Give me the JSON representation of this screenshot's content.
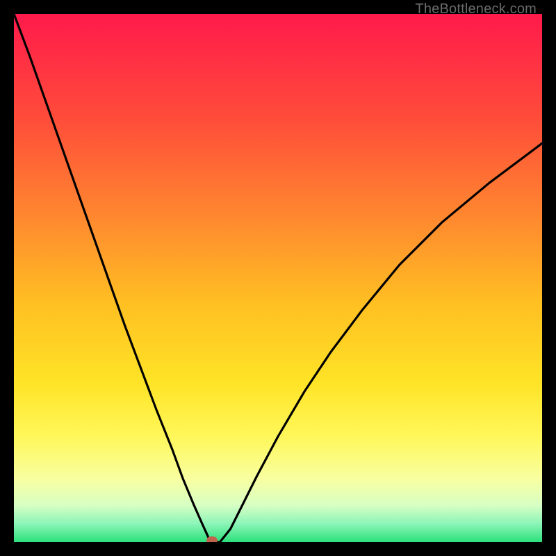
{
  "watermark": "TheBottleneck.com",
  "chart_data": {
    "type": "line",
    "title": "",
    "xlabel": "",
    "ylabel": "",
    "xlim": [
      0,
      100
    ],
    "ylim": [
      0,
      100
    ],
    "grid": false,
    "legend": false,
    "background_gradient": {
      "stops": [
        {
          "pos": 0.0,
          "color": "#ff1a4b"
        },
        {
          "pos": 0.2,
          "color": "#ff4d3a"
        },
        {
          "pos": 0.4,
          "color": "#ff8d2e"
        },
        {
          "pos": 0.55,
          "color": "#ffc022"
        },
        {
          "pos": 0.7,
          "color": "#ffe427"
        },
        {
          "pos": 0.8,
          "color": "#fff75a"
        },
        {
          "pos": 0.88,
          "color": "#f8ffa0"
        },
        {
          "pos": 0.93,
          "color": "#d8ffc4"
        },
        {
          "pos": 0.965,
          "color": "#8cf5b8"
        },
        {
          "pos": 1.0,
          "color": "#2be07a"
        }
      ]
    },
    "marker": {
      "x": 37.5,
      "y": 0,
      "color": "#c0624e",
      "rx": 8,
      "ry": 6
    },
    "series": [
      {
        "name": "bottleneck-curve",
        "x": [
          0,
          3,
          6,
          9,
          12,
          15,
          18,
          21,
          24,
          27,
          30,
          32,
          34,
          35.5,
          36.5,
          37.2,
          39,
          41,
          43,
          46,
          50,
          55,
          60,
          66,
          73,
          81,
          90,
          100
        ],
        "y": [
          100,
          92,
          83.5,
          75,
          66.5,
          58,
          49.5,
          41,
          33,
          25,
          17.5,
          12,
          7.2,
          3.8,
          1.6,
          0.0,
          0.0,
          2.5,
          6.5,
          12.5,
          20,
          28.5,
          36,
          44,
          52.5,
          60.5,
          68,
          75.5
        ]
      }
    ]
  }
}
